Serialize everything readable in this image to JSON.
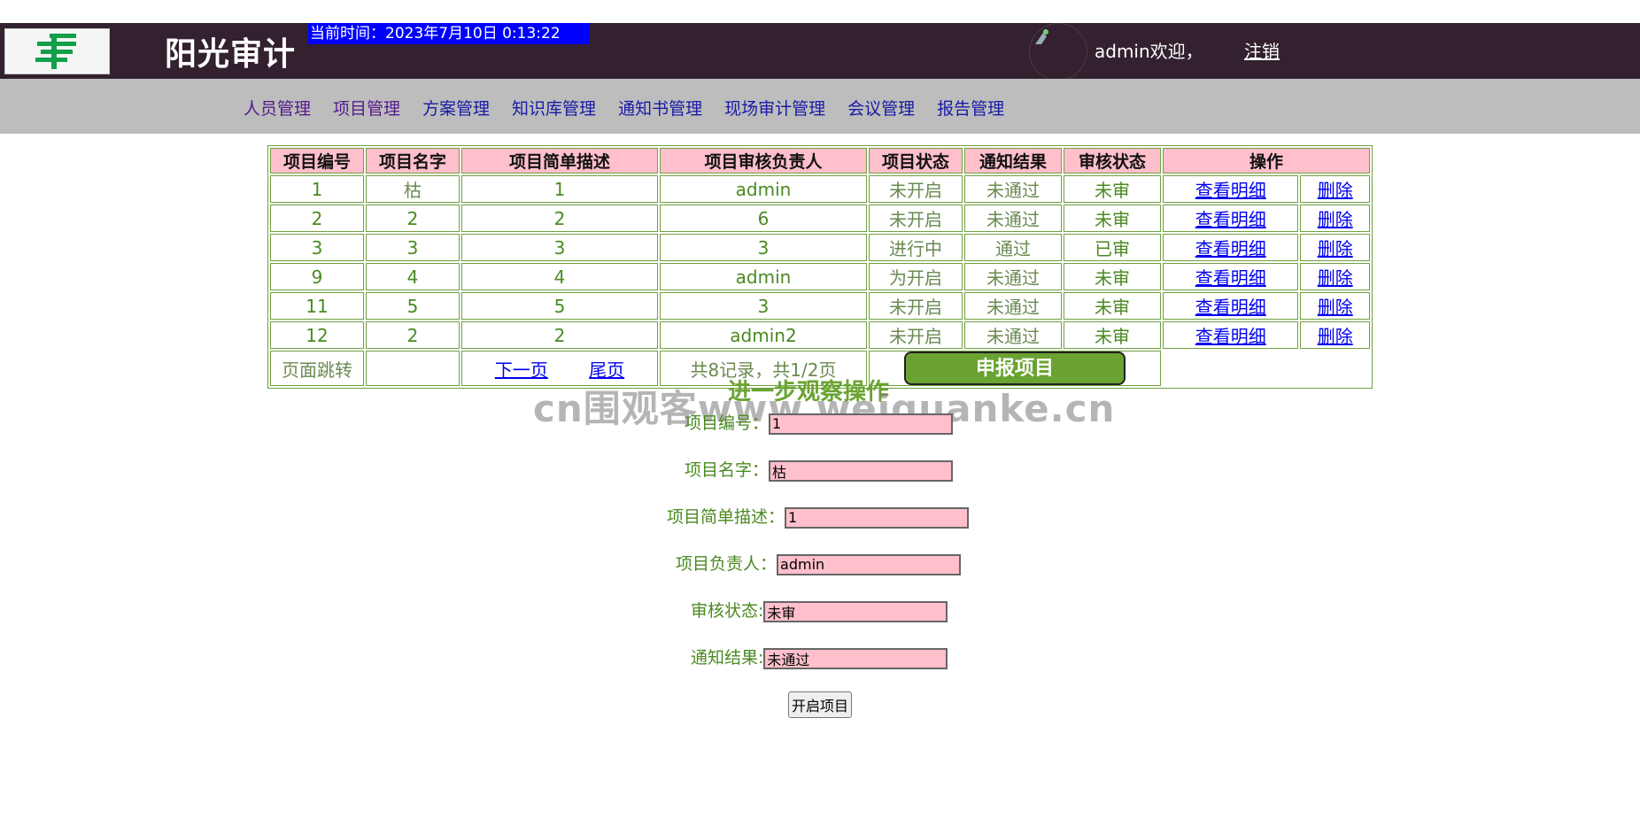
{
  "header": {
    "app_title": "阳光审计",
    "clock": "当前时间：2023年7月10日 0:13:22",
    "welcome": "admin欢迎，",
    "logout": "注销",
    "bg_color": "#33212f"
  },
  "nav": {
    "items": [
      "人员管理",
      "项目管理",
      "方案管理",
      "知识库管理",
      "通知书管理",
      "现场审计管理",
      "会议管理",
      "报告管理"
    ]
  },
  "table": {
    "headers": [
      "项目编号",
      "项目名字",
      "项目简单描述",
      "项目审核负责人",
      "项目状态",
      "通知结果",
      "审核状态",
      "操作"
    ],
    "rows": [
      {
        "id": "1",
        "name": "枯",
        "desc": "1",
        "owner": "admin",
        "status": "未开启",
        "notice": "未通过",
        "audit": "未审",
        "view": "查看明细",
        "del": "删除"
      },
      {
        "id": "2",
        "name": "2",
        "desc": "2",
        "owner": "6",
        "status": "未开启",
        "notice": "未通过",
        "audit": "未审",
        "view": "查看明细",
        "del": "删除"
      },
      {
        "id": "3",
        "name": "3",
        "desc": "3",
        "owner": "3",
        "status": "进行中",
        "notice": "通过",
        "audit": "已审",
        "view": "查看明细",
        "del": "删除"
      },
      {
        "id": "9",
        "name": "4",
        "desc": "4",
        "owner": "admin",
        "status": "为开启",
        "notice": "未通过",
        "audit": "未审",
        "view": "查看明细",
        "del": "删除"
      },
      {
        "id": "11",
        "name": "5",
        "desc": "5",
        "owner": "3",
        "status": "未开启",
        "notice": "未通过",
        "audit": "未审",
        "view": "查看明细",
        "del": "删除"
      },
      {
        "id": "12",
        "name": "2",
        "desc": "2",
        "owner": "admin2",
        "status": "未开启",
        "notice": "未通过",
        "audit": "未审",
        "view": "查看明细",
        "del": "删除"
      }
    ],
    "pager": {
      "jump": "页面跳转",
      "next": "下一页",
      "last": "尾页",
      "summary": "共8记录，共1/2页",
      "apply": "申报项目"
    }
  },
  "detail": {
    "title": "进一步观察操作",
    "watermark": "cn围观客www.weiguanke.cn",
    "fields": [
      {
        "label": "项目编号：",
        "value": "1"
      },
      {
        "label": "项目名字：",
        "value": "枯"
      },
      {
        "label": "项目简单描述：",
        "value": "1"
      },
      {
        "label": "项目负责人：",
        "value": "admin"
      },
      {
        "label": "审核状态:",
        "value": "未审"
      },
      {
        "label": "通知结果:",
        "value": "未通过"
      }
    ],
    "submit": "开启项目"
  },
  "colors": {
    "accent_green": "#6aa332",
    "header_pink": "#ffc0cb",
    "clock_blue": "#0000ff",
    "nav_gray": "#bdbdbd"
  }
}
